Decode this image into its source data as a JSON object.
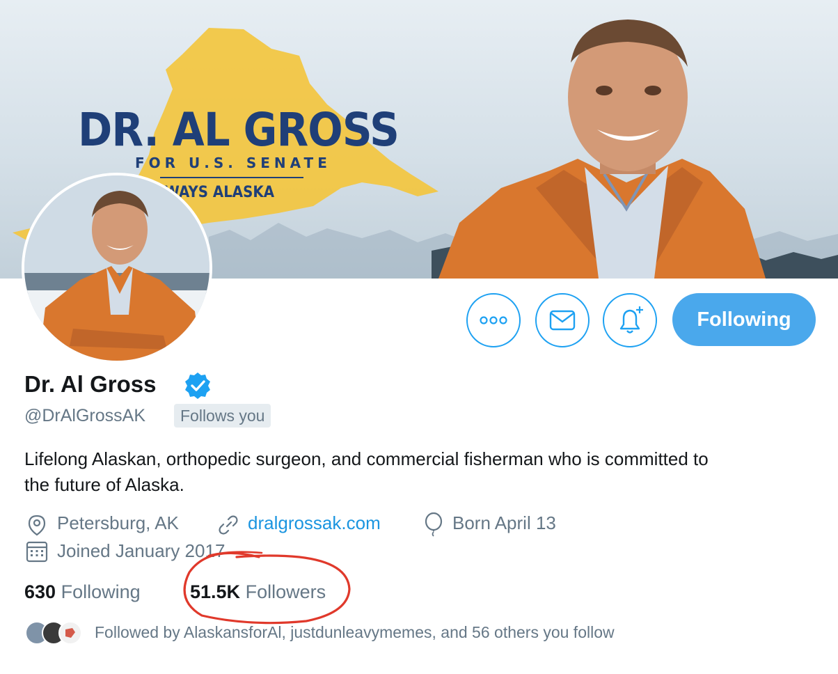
{
  "banner": {
    "title": "DR. AL GROSS",
    "subtitle": "FOR U.S. SENATE",
    "tagline": "WAYS ALASKA"
  },
  "actions": {
    "more_icon": "more-horizontal-icon",
    "message_icon": "envelope-icon",
    "notify_icon": "bell-plus-icon",
    "follow_label": "Following"
  },
  "profile": {
    "name": "Dr. Al Gross",
    "verified_icon": "verified-badge-icon",
    "handle": "@DrAlGrossAK",
    "follows_you": "Follows you",
    "bio": "Lifelong Alaskan, orthopedic surgeon, and commercial fisherman who is committed to the future of Alaska.",
    "location": "Petersburg, AK",
    "website": "dralgrossak.com",
    "birthday": "Born April 13",
    "joined": "Joined January 2017"
  },
  "stats": {
    "following_count": "630",
    "following_label": "Following",
    "followers_count": "51.5K",
    "followers_label": "Followers"
  },
  "followed_by": {
    "text": "Followed by AlaskansforAl, justdunleavymemes, and 56 others you follow"
  },
  "colors": {
    "accent": "#1da1f2",
    "link": "#1b95e0",
    "secondary_text": "#657786",
    "annotation": "#e0392b"
  }
}
